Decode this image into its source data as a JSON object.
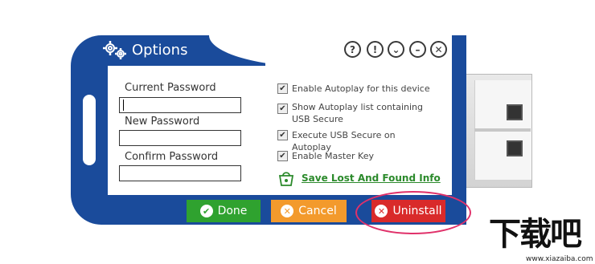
{
  "window": {
    "title": "Options",
    "header_buttons": [
      "?",
      "!",
      "⌄",
      "–",
      "✕"
    ]
  },
  "passwords": {
    "current_label": "Current Password",
    "new_label": "New Password",
    "confirm_label": "Confirm Password",
    "current_value": "",
    "new_value": "",
    "confirm_value": ""
  },
  "options": [
    {
      "label": "Enable Autoplay for this device",
      "checked": true
    },
    {
      "label": "Show Autoplay list containing USB Secure",
      "checked": true
    },
    {
      "label": "Execute USB Secure on Autoplay",
      "checked": true
    },
    {
      "label": "Enable Master Key",
      "checked": true
    }
  ],
  "save_link": "Save Lost And Found Info",
  "buttons": {
    "done": "Done",
    "cancel": "Cancel",
    "uninstall": "Uninstall"
  },
  "colors": {
    "usb_blue": "#1a4b9b",
    "done_green": "#2fa22f",
    "cancel_orange": "#f39a2c",
    "uninstall_red": "#d92a2a",
    "link_green": "#2b8a2b",
    "highlight_pink": "#e0316a"
  },
  "icons": {
    "gears": "gears-icon",
    "done": "check-circle-icon",
    "cancel": "x-circle-icon",
    "uninstall": "x-circle-icon",
    "save": "shopping-bag-icon"
  },
  "watermark": {
    "logo": "下载吧",
    "url": "www.xiazaiba.com"
  }
}
